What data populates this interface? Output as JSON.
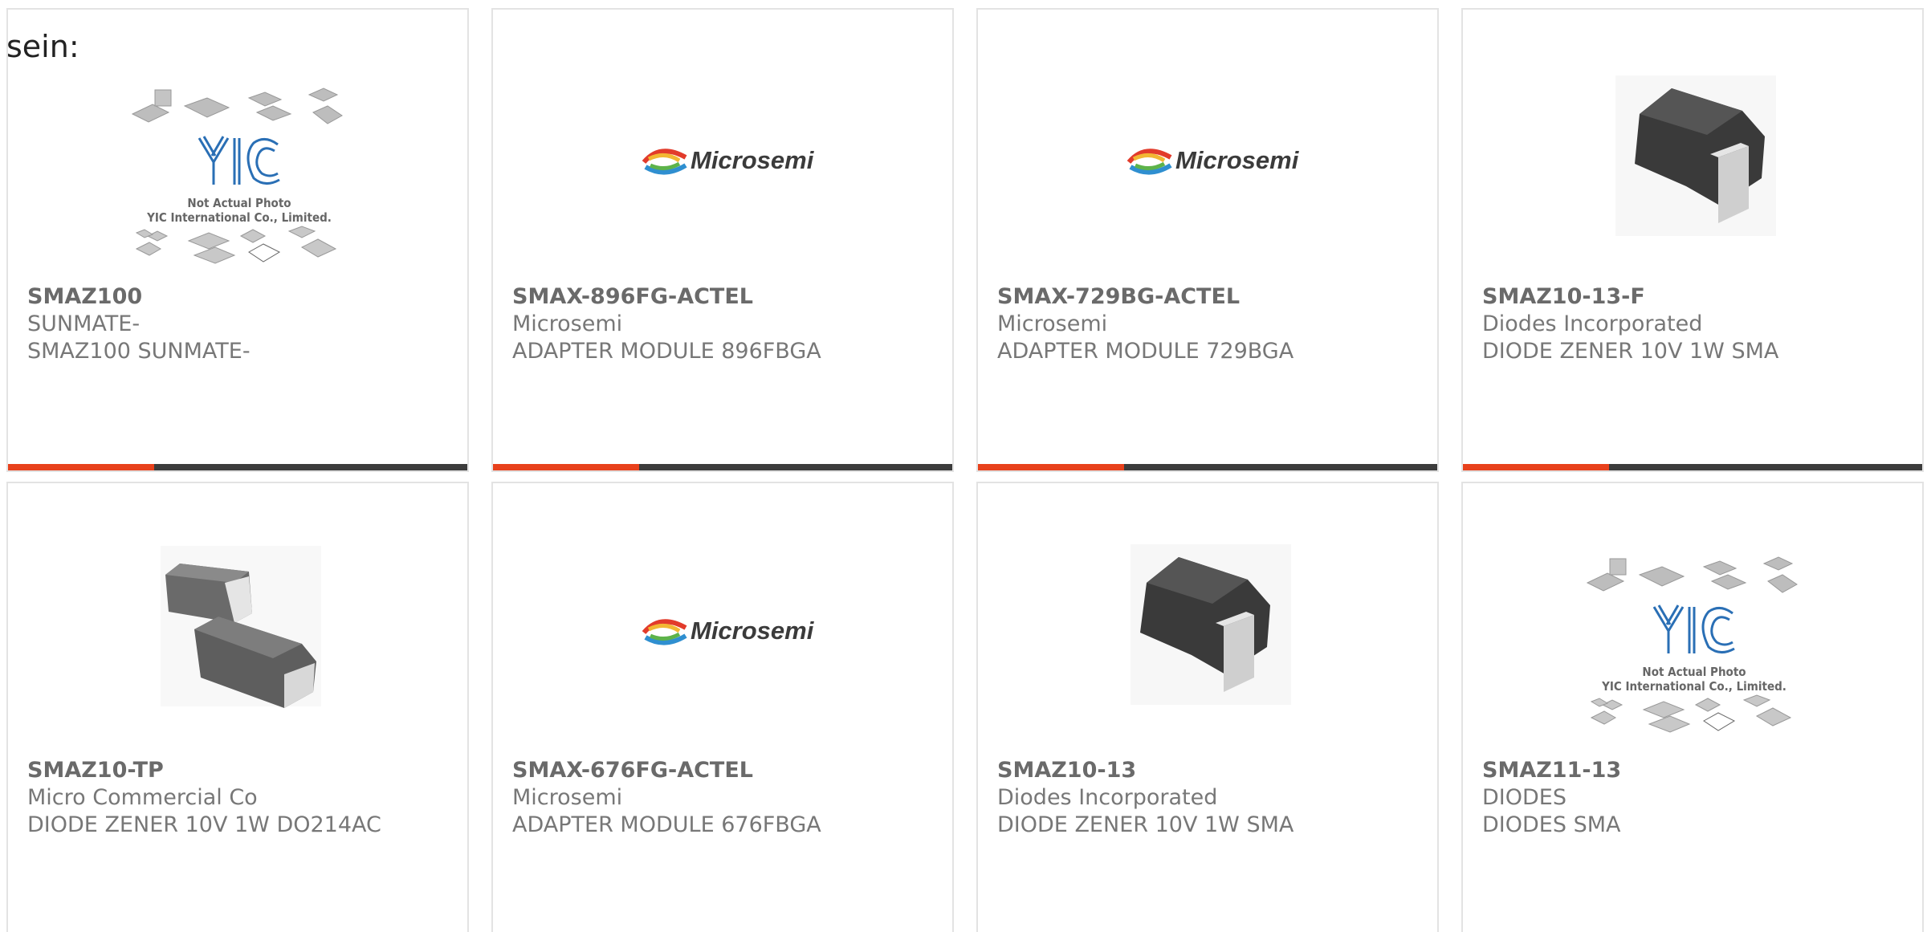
{
  "header": {
    "cut_text": "sein:"
  },
  "image_texts": {
    "microsemi_logo": "Microsemi",
    "placeholder_line1": "Not Actual Photo",
    "placeholder_line2": "YIC International Co., Limited."
  },
  "colors": {
    "accent": "#e8411c",
    "bar_dark": "#3c3c3c",
    "card_border": "#e3e3e3",
    "text_gray": "#777777"
  },
  "products": [
    {
      "part": "SMAZ100",
      "maker": "SUNMATE-",
      "desc": "SMAZ100 SUNMATE-",
      "image": "placeholder-photo-icon"
    },
    {
      "part": "SMAX-896FG-ACTEL",
      "maker": "Microsemi",
      "desc": "ADAPTER MODULE 896FBGA",
      "image": "microsemi-logo"
    },
    {
      "part": "SMAX-729BG-ACTEL",
      "maker": "Microsemi",
      "desc": "ADAPTER MODULE 729BGA",
      "image": "microsemi-logo"
    },
    {
      "part": "SMAZ10-13-F",
      "maker": "Diodes Incorporated",
      "desc": "DIODE ZENER 10V 1W SMA",
      "image": "sma-diode-package-icon"
    },
    {
      "part": "SMAZ10-TP",
      "maker": "Micro Commercial Co",
      "desc": "DIODE ZENER 10V 1W DO214AC",
      "image": "do214ac-diode-pair-icon"
    },
    {
      "part": "SMAX-676FG-ACTEL",
      "maker": "Microsemi",
      "desc": "ADAPTER MODULE 676FBGA",
      "image": "microsemi-logo"
    },
    {
      "part": "SMAZ10-13",
      "maker": "Diodes Incorporated",
      "desc": "DIODE ZENER 10V 1W SMA",
      "image": "sma-diode-package-icon"
    },
    {
      "part": "SMAZ11-13",
      "maker": "DIODES",
      "desc": "DIODES SMA",
      "image": "placeholder-photo-icon"
    }
  ]
}
